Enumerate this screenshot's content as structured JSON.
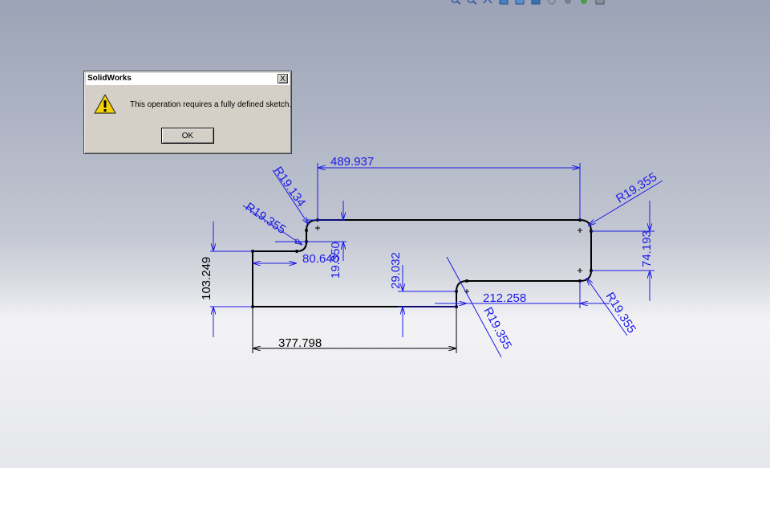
{
  "toolbar": {
    "icons": [
      "zoom-to-fit-icon",
      "zoom-area-icon",
      "previous-view-icon",
      "section-view-icon",
      "view-orientation-icon",
      "display-style-icon",
      "hide-show-icon",
      "edit-appearance-icon",
      "apply-scene-icon",
      "view-settings-icon"
    ]
  },
  "dialog": {
    "title": "SolidWorks",
    "close_label": "X",
    "message": "This operation requires a fully defined sketch.",
    "ok_label": "OK",
    "icon": "warning-icon"
  },
  "sketch": {
    "dimensions": {
      "top_length": "489.937",
      "r_top_left_outer": "R19.134",
      "r_top_left_inner": "R19.355",
      "r_top_right": "R19.355",
      "right_height": "74.193",
      "left_height": "103.249",
      "step_horizontal": "80.640",
      "step_vertical": "19.350",
      "notch_height": "29.032",
      "notch_length": "212.258",
      "r_bottom_right": "R19.355",
      "r_notch": "R19.355",
      "bottom_length": "377.798"
    },
    "colors": {
      "geometry": "#000000",
      "dimension": "#1a1ae6",
      "background_top": "#9ca3b6",
      "background_bottom": "#f3f3f5"
    }
  }
}
